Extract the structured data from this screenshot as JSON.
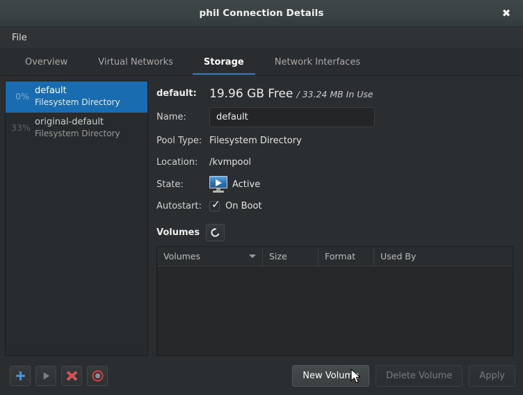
{
  "window": {
    "title": "phil Connection Details",
    "close_icon": "close-icon"
  },
  "menubar": {
    "items": [
      {
        "label": "File"
      }
    ]
  },
  "tabs": [
    {
      "label": "Overview",
      "active": false
    },
    {
      "label": "Virtual Networks",
      "active": false
    },
    {
      "label": "Storage",
      "active": true
    },
    {
      "label": "Network Interfaces",
      "active": false
    }
  ],
  "pool_list": [
    {
      "percent": "0%",
      "name": "default",
      "type": "Filesystem Directory",
      "selected": true
    },
    {
      "percent": "33%",
      "name": "original-default",
      "type": "Filesystem Directory",
      "selected": false
    }
  ],
  "detail": {
    "pool_label": "default:",
    "free_space": "19.96 GB Free",
    "in_use": "/ 33.24 MB In Use",
    "name_label": "Name:",
    "name_value": "default",
    "pool_type_label": "Pool Type:",
    "pool_type_value": "Filesystem Directory",
    "location_label": "Location:",
    "location_value": "/kvmpool",
    "state_label": "State:",
    "state_value": "Active",
    "state_icon": "monitor-play-icon",
    "autostart_label": "Autostart:",
    "autostart_value": "On Boot",
    "autostart_checked": true
  },
  "volumes_section": {
    "title": "Volumes",
    "refresh_icon": "refresh-icon",
    "columns": [
      {
        "label": "Volumes",
        "sorted": true
      },
      {
        "label": "Size",
        "sorted": false
      },
      {
        "label": "Format",
        "sorted": false
      },
      {
        "label": "Used By",
        "sorted": false
      }
    ],
    "rows": []
  },
  "toolbar": {
    "icon_buttons": [
      {
        "name": "add-pool-button",
        "icon": "plus-icon",
        "enabled": true
      },
      {
        "name": "start-pool-button",
        "icon": "play-icon",
        "enabled": false
      },
      {
        "name": "delete-pool-button",
        "icon": "x-delete-icon",
        "enabled": true
      },
      {
        "name": "stop-pool-button",
        "icon": "stop-icon",
        "enabled": true
      }
    ],
    "new_volume_label": "New Volume",
    "delete_volume_label": "Delete Volume",
    "apply_label": "Apply"
  },
  "colors": {
    "accent_blue": "#2b6cb0",
    "selection_blue": "#1a6cb0",
    "window_bg": "#2b2e30",
    "titlebar_top": "#3f4749",
    "delete_red": "#e03a3a"
  }
}
